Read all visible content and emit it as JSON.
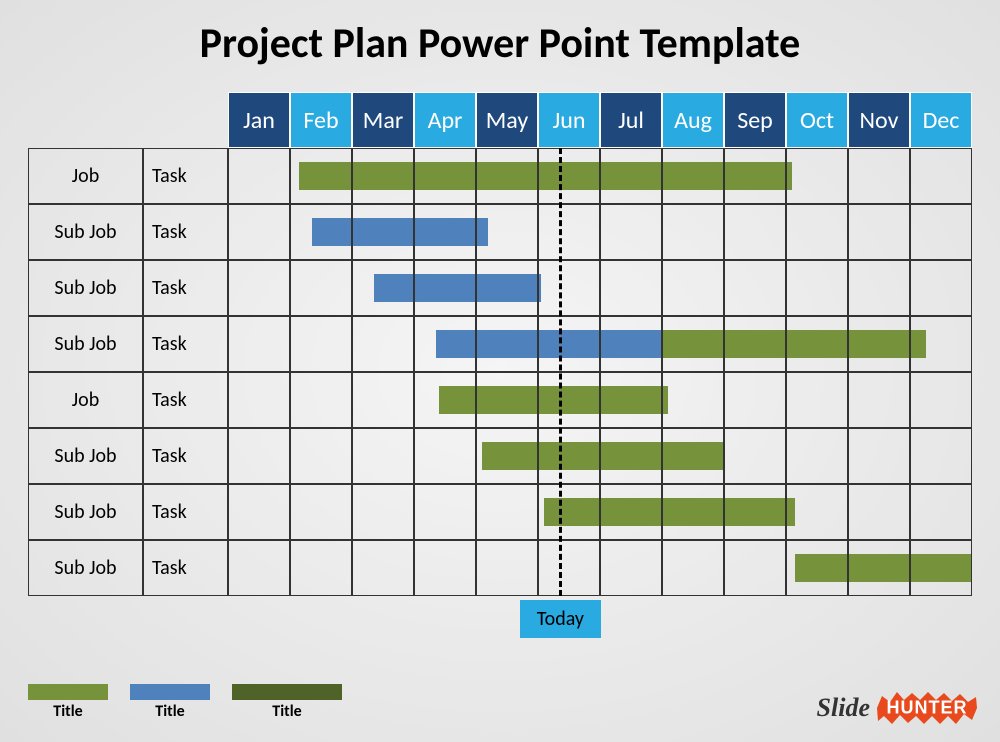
{
  "title": "Project Plan Power Point Template",
  "months": [
    "Jan",
    "Feb",
    "Mar",
    "Apr",
    "May",
    "Jun",
    "Jul",
    "Aug",
    "Sep",
    "Oct",
    "Nov",
    "Dec"
  ],
  "month_colors": [
    "dark",
    "light",
    "dark",
    "light",
    "dark",
    "light",
    "dark",
    "light",
    "dark",
    "light",
    "dark",
    "light"
  ],
  "rows": [
    {
      "job": "Job",
      "task": "Task"
    },
    {
      "job": "Sub Job",
      "task": "Task"
    },
    {
      "job": "Sub Job",
      "task": "Task"
    },
    {
      "job": "Sub Job",
      "task": "Task"
    },
    {
      "job": "Job",
      "task": "Task"
    },
    {
      "job": "Sub Job",
      "task": "Task"
    },
    {
      "job": "Sub Job",
      "task": "Task"
    },
    {
      "job": "Sub Job",
      "task": "Task"
    }
  ],
  "today": {
    "label": "Today",
    "position_pct": 44.5
  },
  "legend": [
    {
      "label": "Title",
      "class": "g1"
    },
    {
      "label": "Title",
      "class": "b1"
    },
    {
      "label": "Title",
      "class": "g2"
    }
  ],
  "brand": {
    "slide": "Slide",
    "hunter": "HUNTER"
  },
  "chart_data": {
    "type": "bar",
    "title": "Project Plan Power Point Template",
    "xlabel": "",
    "ylabel": "",
    "categories": [
      "Jan",
      "Feb",
      "Mar",
      "Apr",
      "May",
      "Jun",
      "Jul",
      "Aug",
      "Sep",
      "Oct",
      "Nov",
      "Dec"
    ],
    "xlim": [
      0,
      12
    ],
    "today_marker": 5.35,
    "series": [
      {
        "row": 0,
        "name": "Job / Task",
        "segments": [
          {
            "start": 1.15,
            "end": 5.35,
            "color": "green"
          },
          {
            "start": 5.35,
            "end": 9.1,
            "color": "green"
          }
        ]
      },
      {
        "row": 1,
        "name": "Sub Job / Task",
        "segments": [
          {
            "start": 1.35,
            "end": 4.2,
            "color": "blue"
          }
        ]
      },
      {
        "row": 2,
        "name": "Sub Job / Task",
        "segments": [
          {
            "start": 2.35,
            "end": 5.05,
            "color": "blue"
          }
        ]
      },
      {
        "row": 3,
        "name": "Sub Job / Task",
        "segments": [
          {
            "start": 3.35,
            "end": 7.0,
            "color": "blue"
          },
          {
            "start": 7.0,
            "end": 11.25,
            "color": "green"
          }
        ]
      },
      {
        "row": 4,
        "name": "Job / Task",
        "segments": [
          {
            "start": 3.4,
            "end": 7.1,
            "color": "green"
          }
        ]
      },
      {
        "row": 5,
        "name": "Sub Job / Task",
        "segments": [
          {
            "start": 4.1,
            "end": 8.0,
            "color": "green"
          }
        ]
      },
      {
        "row": 6,
        "name": "Sub Job / Task",
        "segments": [
          {
            "start": 5.1,
            "end": 9.15,
            "color": "green"
          }
        ]
      },
      {
        "row": 7,
        "name": "Sub Job / Task",
        "segments": [
          {
            "start": 9.15,
            "end": 12.0,
            "color": "green"
          }
        ]
      }
    ]
  }
}
